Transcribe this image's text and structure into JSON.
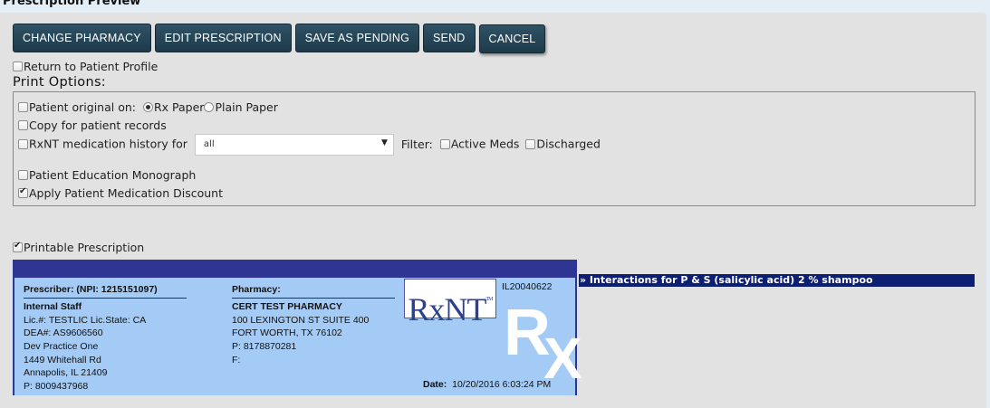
{
  "page": {
    "title": "Prescription Preview"
  },
  "toolbar": {
    "change_pharmacy": "CHANGE PHARMACY",
    "edit_prescription": "EDIT PRESCRIPTION",
    "save_as_pending": "SAVE AS PENDING",
    "send": "SEND",
    "cancel": "CANCEL"
  },
  "return_profile": {
    "label": "Return to Patient Profile",
    "checked": false
  },
  "print_options": {
    "title": "Print Options:",
    "patient_original": {
      "label": "Patient original on:",
      "checked": false,
      "options": [
        "Rx Paper",
        "Plain Paper"
      ],
      "selected": "Rx Paper"
    },
    "copy_records": {
      "label": "Copy for patient records",
      "checked": false
    },
    "med_history": {
      "label": "RxNT medication history for",
      "checked": false,
      "select_value": "all",
      "filter_label": "Filter:",
      "active_meds": "Active Meds",
      "discharged": "Discharged"
    },
    "education": {
      "label": "Patient Education Monograph",
      "checked": false
    },
    "discount": {
      "label": "Apply Patient Medication Discount",
      "checked": true
    }
  },
  "printable": {
    "label": "Printable Prescription",
    "checked": true
  },
  "rx": {
    "prescriber_header": "Prescriber: (NPI: 1215151097)",
    "prescriber_name": "Internal Staff",
    "lic": "Lic.#: TESTLIC Lic.State: CA",
    "dea": "DEA#: AS9606560",
    "practice": "Dev Practice One",
    "address1": "1449 Whitehall Rd",
    "address2": "Annapolis,  IL 21409",
    "phone": "P: 8009437968",
    "pharmacy_header": "Pharmacy:",
    "pharmacy_name": "CERT TEST PHARMACY",
    "pharmacy_address1": "100 LEXINGTON ST SUITE 400",
    "pharmacy_address2": "FORT WORTH,  TX 76102",
    "pharmacy_phone": "P: 8178870281",
    "pharmacy_fax": "F:",
    "logo_text": "RxNT",
    "logo_tm": "TM",
    "id": "IL20040622",
    "big_r": "R",
    "big_x": "X",
    "date_label": "Date:",
    "date_value": "10/20/2016 6:03:24 PM"
  },
  "interactions": {
    "label": "» Interactions for P & S (salicylic acid) 2 % shampoo"
  }
}
